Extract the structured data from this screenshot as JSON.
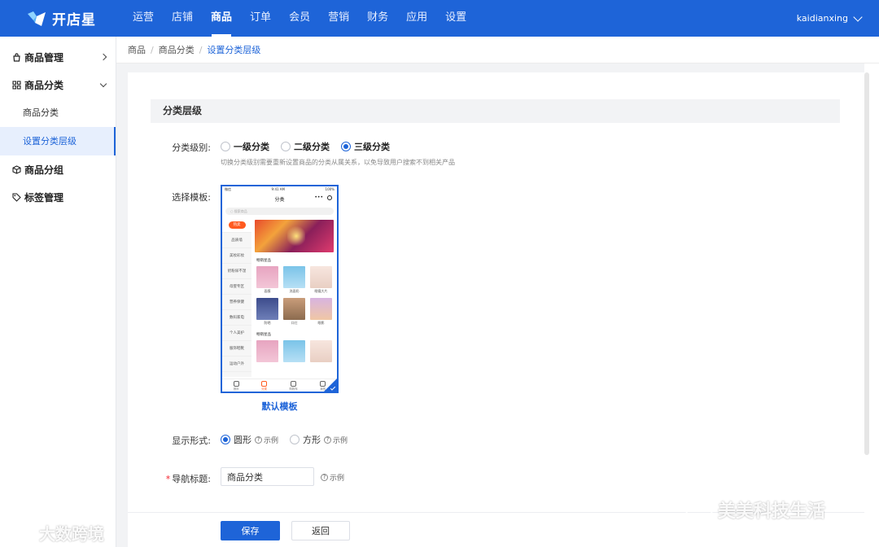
{
  "app": {
    "logo_text": "开店星",
    "user_name": "kaidianxing"
  },
  "nav": {
    "items": [
      {
        "label": "运营"
      },
      {
        "label": "店铺"
      },
      {
        "label": "商品",
        "active": true
      },
      {
        "label": "订单"
      },
      {
        "label": "会员"
      },
      {
        "label": "营销"
      },
      {
        "label": "财务"
      },
      {
        "label": "应用"
      },
      {
        "label": "设置"
      }
    ]
  },
  "sidebar": {
    "groups": [
      {
        "label": "商品管理",
        "icon": "bag-icon"
      },
      {
        "label": "商品分类",
        "icon": "category-icon",
        "subitems": [
          {
            "label": "商品分类"
          },
          {
            "label": "设置分类层级",
            "active": true
          }
        ]
      },
      {
        "label": "商品分组",
        "icon": "cube-icon"
      },
      {
        "label": "标签管理",
        "icon": "tag-icon"
      }
    ]
  },
  "breadcrumb": [
    "商品",
    "商品分类",
    "设置分类层级"
  ],
  "form": {
    "section_title": "分类层级",
    "level": {
      "label": "分类级别:",
      "options": [
        "一级分类",
        "二级分类",
        "三级分类"
      ],
      "selected": "三级分类",
      "hint": "切换分类级别需要重新设置商品的分类从属关系，以免导致用户搜索不到相关产品"
    },
    "template": {
      "label": "选择模板:",
      "name": "默认模板",
      "preview": {
        "status_carrier": "微信",
        "status_time": "9:41 AM",
        "status_battery": "100%",
        "title": "分类",
        "search_placeholder": "搜索商品",
        "categories": [
          "热卖",
          "品质墙",
          "美妆彩妆",
          "奶粉尿不湿",
          "母婴专区",
          "营养保健",
          "数码家电",
          "个人美护",
          "服饰鞋靴",
          "运动户外"
        ],
        "section1": "畅销星品",
        "section2": "畅销星品",
        "products": [
          "面膜",
          "洗面奶",
          "眼霜大片",
          "防晒",
          "口红",
          "眼影"
        ],
        "tabs": [
          "首页",
          "分类",
          "购物车",
          "我的"
        ]
      }
    },
    "display": {
      "label": "显示形式:",
      "options": [
        "圆形",
        "方形"
      ],
      "selected": "圆形",
      "example_label": "示例"
    },
    "nav_title": {
      "label": "导航标题:",
      "required_mark": "*",
      "value": "商品分类",
      "example_label": "示例"
    },
    "buttons": {
      "save": "保存",
      "back": "返回"
    }
  },
  "watermarks": {
    "left": "大数跨境",
    "right": "美美科技生活"
  },
  "colors": {
    "primary": "#1e64d8",
    "accent_orange": "#ff5a1f",
    "required_red": "#f5222d"
  }
}
